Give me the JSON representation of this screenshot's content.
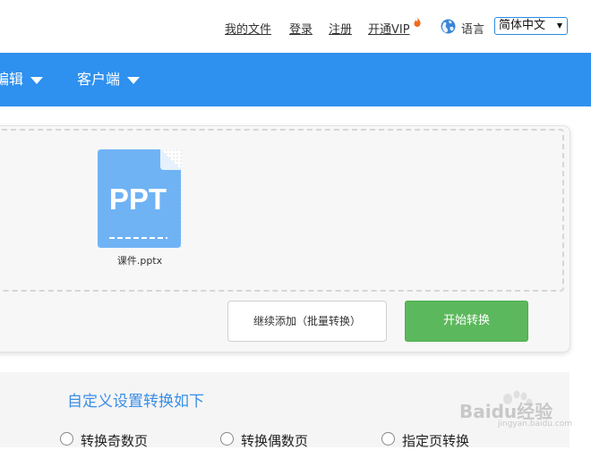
{
  "header": {
    "links": [
      "我的文件",
      "登录",
      "注册",
      "开通VIP"
    ],
    "language_label": "语言",
    "language_selected": "简体中文"
  },
  "nav": {
    "items": [
      "编辑",
      "客户端"
    ]
  },
  "upload": {
    "file_icon_text": "PPT",
    "file_name": "课件.pptx",
    "add_button": "继续添加（批量转换）",
    "start_button": "开始转换"
  },
  "settings": {
    "title": "自定义设置转换如下",
    "options": [
      "转换奇数页",
      "转换偶数页",
      "指定页转换"
    ]
  },
  "watermark": {
    "text": "Baidu经验",
    "sub": "jingyan.baidu.com"
  },
  "colors": {
    "nav_blue": "#2e90ef",
    "start_green": "#5cb85c",
    "file_icon_blue": "#6fb3f5",
    "settings_title": "#3a8ee6"
  },
  "icons": [
    "fire-icon",
    "globe-icon",
    "chevron-down-icon",
    "ppt-file-icon",
    "radio-icon",
    "baidu-paw-icon"
  ]
}
